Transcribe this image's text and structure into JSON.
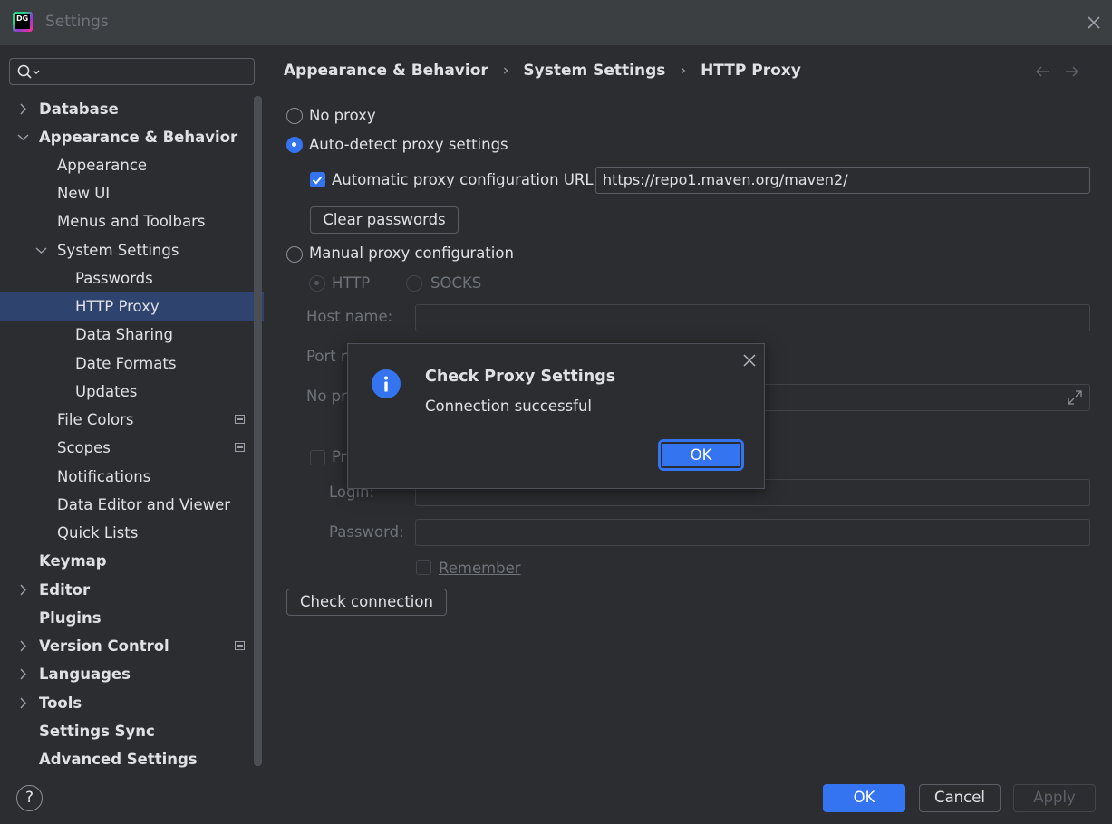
{
  "window": {
    "title": "Settings",
    "app_badge": "DG"
  },
  "search": {
    "placeholder": ""
  },
  "sidebar": {
    "items": [
      {
        "label": "Database"
      },
      {
        "label": "Appearance & Behavior"
      },
      {
        "label": "Appearance"
      },
      {
        "label": "New UI"
      },
      {
        "label": "Menus and Toolbars"
      },
      {
        "label": "System Settings"
      },
      {
        "label": "Passwords"
      },
      {
        "label": "HTTP Proxy"
      },
      {
        "label": "Data Sharing"
      },
      {
        "label": "Date Formats"
      },
      {
        "label": "Updates"
      },
      {
        "label": "File Colors"
      },
      {
        "label": "Scopes"
      },
      {
        "label": "Notifications"
      },
      {
        "label": "Data Editor and Viewer"
      },
      {
        "label": "Quick Lists"
      },
      {
        "label": "Keymap"
      },
      {
        "label": "Editor"
      },
      {
        "label": "Plugins"
      },
      {
        "label": "Version Control"
      },
      {
        "label": "Languages"
      },
      {
        "label": "Tools"
      },
      {
        "label": "Settings Sync"
      },
      {
        "label": "Advanced Settings"
      }
    ]
  },
  "breadcrumb": {
    "part1": "Appearance & Behavior",
    "part2": "System Settings",
    "part3": "HTTP Proxy",
    "sep": "›"
  },
  "proxy": {
    "no_proxy": "No proxy",
    "auto_detect": "Auto-detect proxy settings",
    "auto_url_label": "Automatic proxy configuration URL:",
    "auto_url_value": "https://repo1.maven.org/maven2/",
    "clear_passwords": "Clear passwords",
    "manual": "Manual proxy configuration",
    "http": "HTTP",
    "socks": "SOCKS",
    "host_name": "Host name:",
    "port_partial": "Port n",
    "no_proxy_partial": "No pr",
    "proxy_auth_partial": "Pr",
    "login": "Login:",
    "password": "Password:",
    "remember": "Remember",
    "check_connection": "Check connection"
  },
  "dialog": {
    "title": "Check Proxy Settings",
    "message": "Connection successful",
    "ok": "OK"
  },
  "footer": {
    "help": "?",
    "ok": "OK",
    "cancel": "Cancel",
    "apply": "Apply"
  },
  "colors": {
    "accent": "#3574f0",
    "selection": "#2e436e",
    "background": "#2b2d30",
    "titlebar": "#3c3f41"
  }
}
